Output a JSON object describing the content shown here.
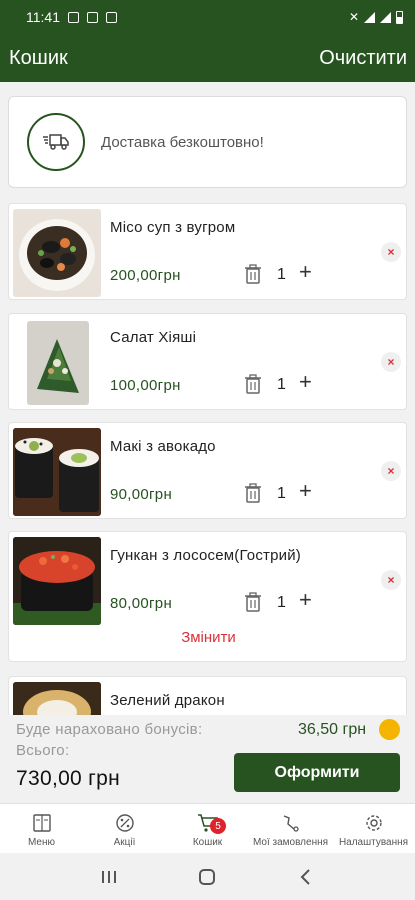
{
  "status_bar": {
    "time": "11:41"
  },
  "header": {
    "title": "Кошик",
    "clear_label": "Очистити"
  },
  "delivery": {
    "text": "Доставка безкоштовно!",
    "icon": "delivery-truck-icon"
  },
  "cart": {
    "items": [
      {
        "name": "Місо суп з вугром",
        "price": "200,00грн",
        "qty": "1"
      },
      {
        "name": "Салат Хіяші",
        "price": "100,00грн",
        "qty": "1"
      },
      {
        "name": "Макі з авокадо",
        "price": "90,00грн",
        "qty": "1"
      },
      {
        "name": "Гункан з лососем(Гострий)",
        "price": "80,00грн",
        "qty": "1",
        "change_label": "Змінити"
      },
      {
        "name": "Зелений дракон"
      }
    ],
    "remove_symbol": "×",
    "plus_symbol": "+"
  },
  "summary": {
    "bonus_label": "Буде нараховано бонусів:",
    "bonus_value": "36,50 грн",
    "total_label": "Всього:",
    "total_value": "730,00 грн",
    "checkout_label": "Оформити"
  },
  "bottom_nav": {
    "items": [
      {
        "label": "Меню",
        "icon": "menu-book-icon"
      },
      {
        "label": "Акції",
        "icon": "percent-icon"
      },
      {
        "label": "Кошик",
        "icon": "cart-icon",
        "badge": "5"
      },
      {
        "label": "Мої замовлення",
        "icon": "orders-icon"
      },
      {
        "label": "Налаштування",
        "icon": "gear-icon"
      }
    ]
  },
  "colors": {
    "primary": "#275320",
    "accent": "#d8323a",
    "background": "#f1f1f1",
    "coin": "#f5b400"
  }
}
